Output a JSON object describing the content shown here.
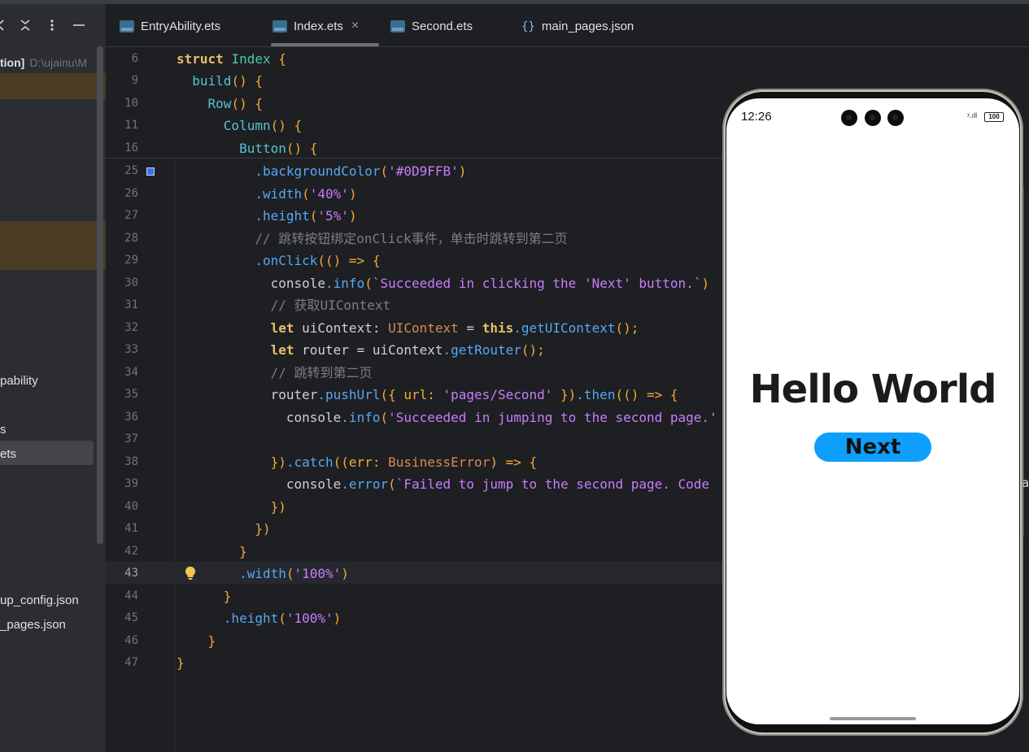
{
  "sidebar": {
    "tools": [
      "expand-icon",
      "collapse-icon",
      "more-icon",
      "hide-icon"
    ],
    "root_bold": "tion]",
    "root_path": "D:\\ujainu\\M",
    "items": [
      {
        "label": "pability"
      },
      {
        "label": "s"
      },
      {
        "label": "ets"
      },
      {
        "label": "up_config.json"
      },
      {
        "label": "_pages.json"
      }
    ]
  },
  "tabs": [
    {
      "label": "EntryAbility.ets",
      "icon": "ets-file-icon"
    },
    {
      "label": "Index.ets",
      "icon": "ets-file-icon",
      "active": true,
      "close": "×"
    },
    {
      "label": "Second.ets",
      "icon": "ets-file-icon"
    },
    {
      "label": "main_pages.json",
      "icon": "json-file-icon",
      "icon_glyph": "{}"
    }
  ],
  "editor": {
    "current_line": "43",
    "lines": [
      {
        "n": "6"
      },
      {
        "n": "9"
      },
      {
        "n": "10"
      },
      {
        "n": "11"
      },
      {
        "n": "16"
      },
      {
        "n": "25"
      },
      {
        "n": "26"
      },
      {
        "n": "27"
      },
      {
        "n": "28"
      },
      {
        "n": "29"
      },
      {
        "n": "30"
      },
      {
        "n": "31"
      },
      {
        "n": "32"
      },
      {
        "n": "33"
      },
      {
        "n": "34"
      },
      {
        "n": "35"
      },
      {
        "n": "36"
      },
      {
        "n": "37"
      },
      {
        "n": "38"
      },
      {
        "n": "39"
      },
      {
        "n": "40"
      },
      {
        "n": "41"
      },
      {
        "n": "42"
      },
      {
        "n": "43"
      },
      {
        "n": "44"
      },
      {
        "n": "45"
      },
      {
        "n": "46"
      },
      {
        "n": "47"
      }
    ],
    "code": {
      "l6_kw": "struct",
      "l6_name": "Index",
      "l6_br": "{",
      "l9_fn": "build",
      "l9_p": "()",
      "l9_br": "{",
      "l10_fn": "Row",
      "l10_p": "()",
      "l10_br": "{",
      "l11_fn": "Column",
      "l11_p": "()",
      "l11_br": "{",
      "l16_fn": "Button",
      "l16_p": "()",
      "l16_br": "{",
      "l25_m": ".backgroundColor",
      "l25_a": "(",
      "l25_s": "'#0D9FFB'",
      "l25_b": ")",
      "l26_m": ".width",
      "l26_a": "(",
      "l26_s": "'40%'",
      "l26_b": ")",
      "l27_m": ".height",
      "l27_a": "(",
      "l27_s": "'5%'",
      "l27_b": ")",
      "l28_c": "// 跳转按钮绑定onClick事件，单击时跳转到第二页",
      "l29_m": ".onClick",
      "l29_a": "((",
      "l29_b": ") => {",
      "l30_o": "console",
      "l30_m": ".info",
      "l30_a": "(",
      "l30_s": "`Succeeded in clicking the 'Next' button.`",
      "l30_b": ")",
      "l31_c": "// 获取UIContext",
      "l32_k": "let",
      "l32_v": " uiContext: ",
      "l32_t": "UIContext",
      "l32_e": " = ",
      "l32_this": "this",
      "l32_m": ".getUIContext",
      "l32_p": "();",
      "l33_k": "let",
      "l33_v": " router = uiContext",
      "l33_m": ".getRouter",
      "l33_p": "();",
      "l34_c": "// 跳转到第二页",
      "l35_o": "router",
      "l35_m": ".pushUrl",
      "l35_a": "({ url: ",
      "l35_s": "'pages/Second'",
      "l35_b": " })",
      "l35_m2": ".then",
      "l35_c": "(() => {",
      "l36_o": "console",
      "l36_m": ".info",
      "l36_a": "(",
      "l36_s": "'Succeeded in jumping to the second page.'",
      "l38_a": "})",
      "l38_m": ".catch",
      "l38_b": "((err: ",
      "l38_t": "BusinessError",
      "l38_c": ") => {",
      "l39_o": "console",
      "l39_m": ".error",
      "l39_a": "(",
      "l39_s": "`Failed to jump to the second page. Code",
      "l40": "})",
      "l41": "})",
      "l42": "}",
      "l43_m": ".width",
      "l43_a": "(",
      "l43_s": "'100%'",
      "l43_b": ")",
      "l44": "}",
      "l45_m": ".height",
      "l45_a": "(",
      "l45_s": "'100%'",
      "l45_b": ")",
      "l46": "}",
      "l47": "}"
    }
  },
  "preview": {
    "time": "12:26",
    "battery": "100",
    "signal": "ᵡ.ıll",
    "hello": "Hello World",
    "button": "Next",
    "button_color": "#0D9FFB"
  },
  "right_edge_char": "a"
}
